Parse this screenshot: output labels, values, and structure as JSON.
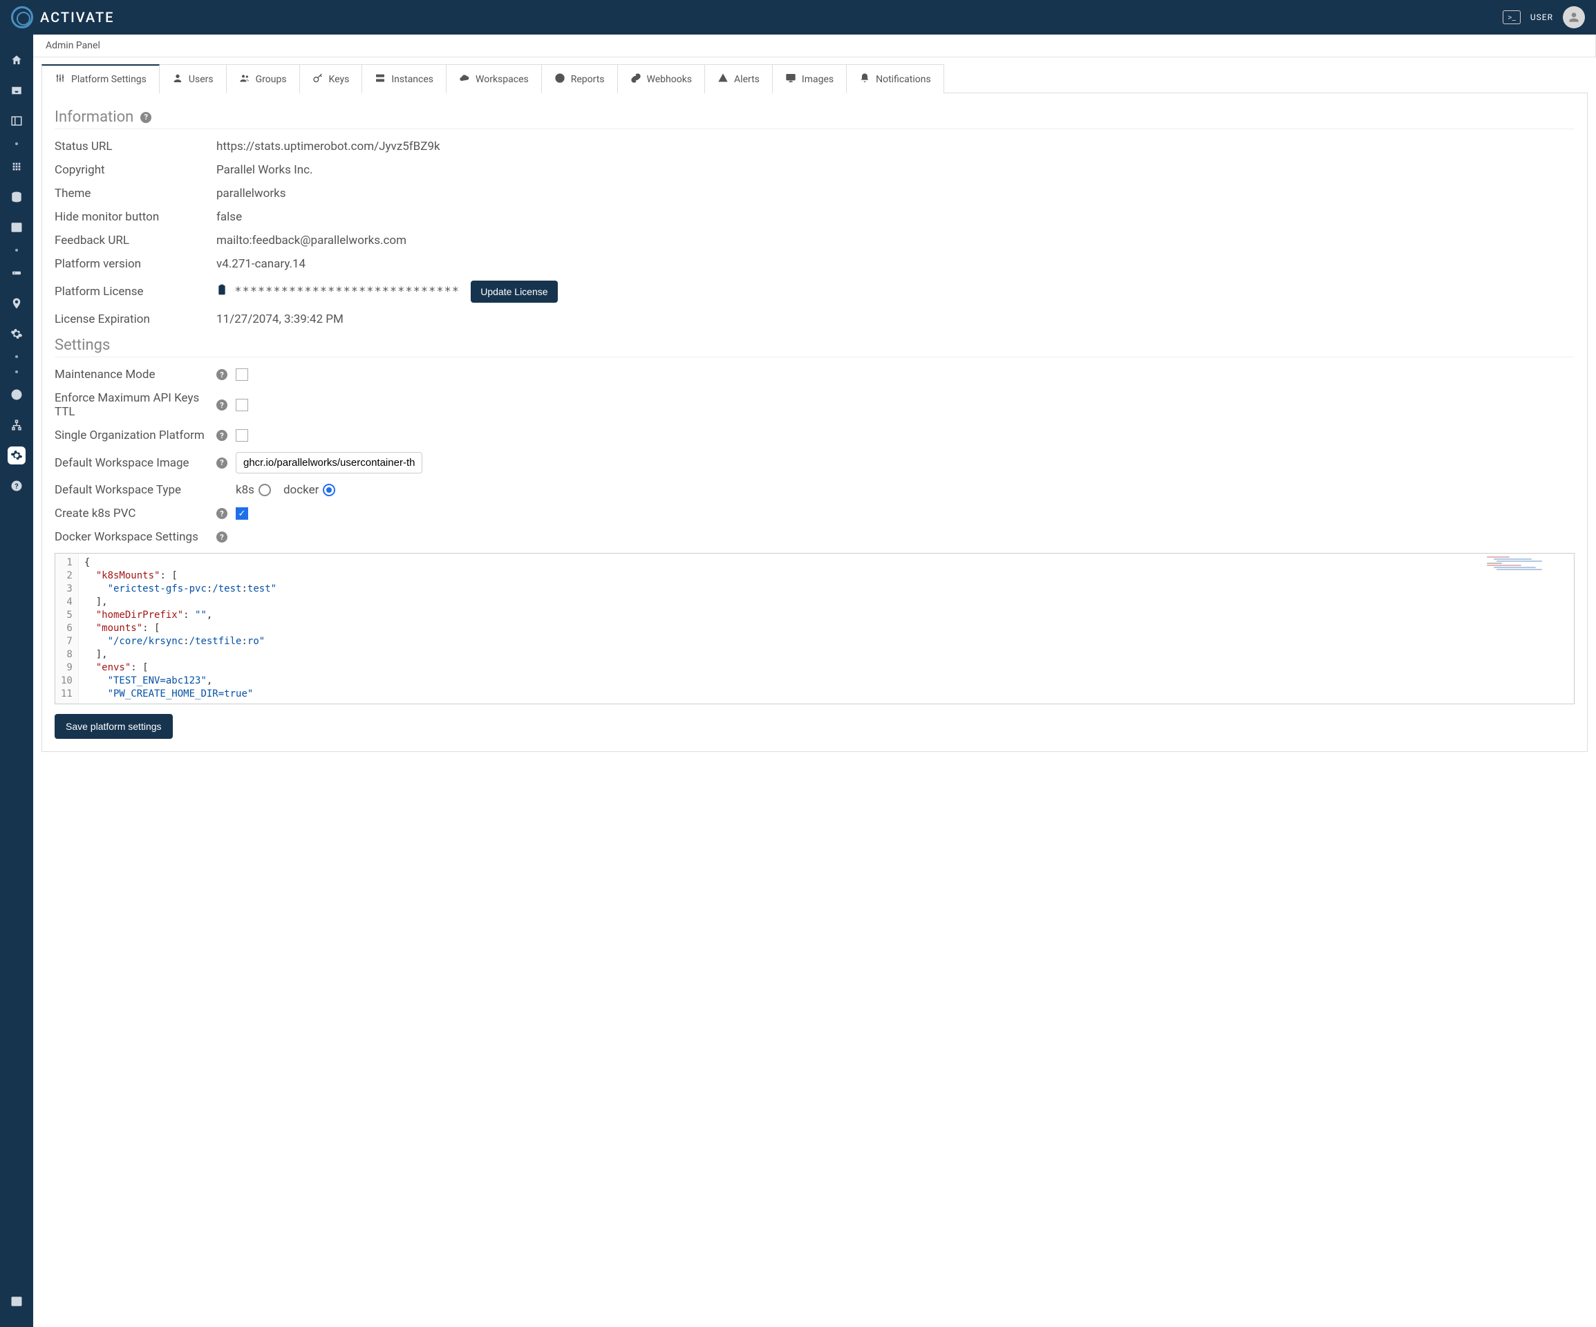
{
  "header": {
    "brand": "ACTIVATE",
    "user_label": "USER"
  },
  "breadcrumb": "Admin Panel",
  "tabs": [
    {
      "label": "Platform Settings",
      "icon": "sliders"
    },
    {
      "label": "Users",
      "icon": "user"
    },
    {
      "label": "Groups",
      "icon": "users"
    },
    {
      "label": "Keys",
      "icon": "key"
    },
    {
      "label": "Instances",
      "icon": "server"
    },
    {
      "label": "Workspaces",
      "icon": "cloud"
    },
    {
      "label": "Reports",
      "icon": "pie"
    },
    {
      "label": "Webhooks",
      "icon": "link"
    },
    {
      "label": "Alerts",
      "icon": "alert"
    },
    {
      "label": "Images",
      "icon": "monitor"
    },
    {
      "label": "Notifications",
      "icon": "bell"
    }
  ],
  "information": {
    "title": "Information",
    "rows": {
      "status_url_label": "Status URL",
      "status_url_value": "https://stats.uptimerobot.com/Jyvz5fBZ9k",
      "copyright_label": "Copyright",
      "copyright_value": "Parallel Works Inc.",
      "theme_label": "Theme",
      "theme_value": "parallelworks",
      "hide_monitor_label": "Hide monitor button",
      "hide_monitor_value": "false",
      "feedback_label": "Feedback URL",
      "feedback_value": "mailto:feedback@parallelworks.com",
      "version_label": "Platform version",
      "version_value": "v4.271-canary.14",
      "license_label": "Platform License",
      "license_mask": "*****************************",
      "update_license_btn": "Update License",
      "expiration_label": "License Expiration",
      "expiration_value": "11/27/2074, 3:39:42 PM"
    }
  },
  "settings": {
    "title": "Settings",
    "maintenance_label": "Maintenance Mode",
    "maintenance_checked": false,
    "enforce_ttl_label": "Enforce Maximum API Keys TTL",
    "enforce_ttl_checked": false,
    "single_org_label": "Single Organization Platform",
    "single_org_checked": false,
    "default_image_label": "Default Workspace Image",
    "default_image_value": "ghcr.io/parallelworks/usercontainer-th",
    "default_type_label": "Default Workspace Type",
    "type_k8s": "k8s",
    "type_docker": "docker",
    "type_selected": "docker",
    "create_pvc_label": "Create k8s PVC",
    "create_pvc_checked": true,
    "docker_ws_label": "Docker Workspace Settings",
    "code_lines": [
      "{",
      "  \"k8sMounts\": [",
      "    \"erictest-gfs-pvc:/test:test\"",
      "  ],",
      "  \"homeDirPrefix\": \"\",",
      "  \"mounts\": [",
      "    \"/core/krsync:/testfile:ro\"",
      "  ],",
      "  \"envs\": [",
      "    \"TEST_ENV=abc123\",",
      "    \"PW_CREATE_HOME_DIR=true\""
    ],
    "save_btn": "Save platform settings"
  }
}
